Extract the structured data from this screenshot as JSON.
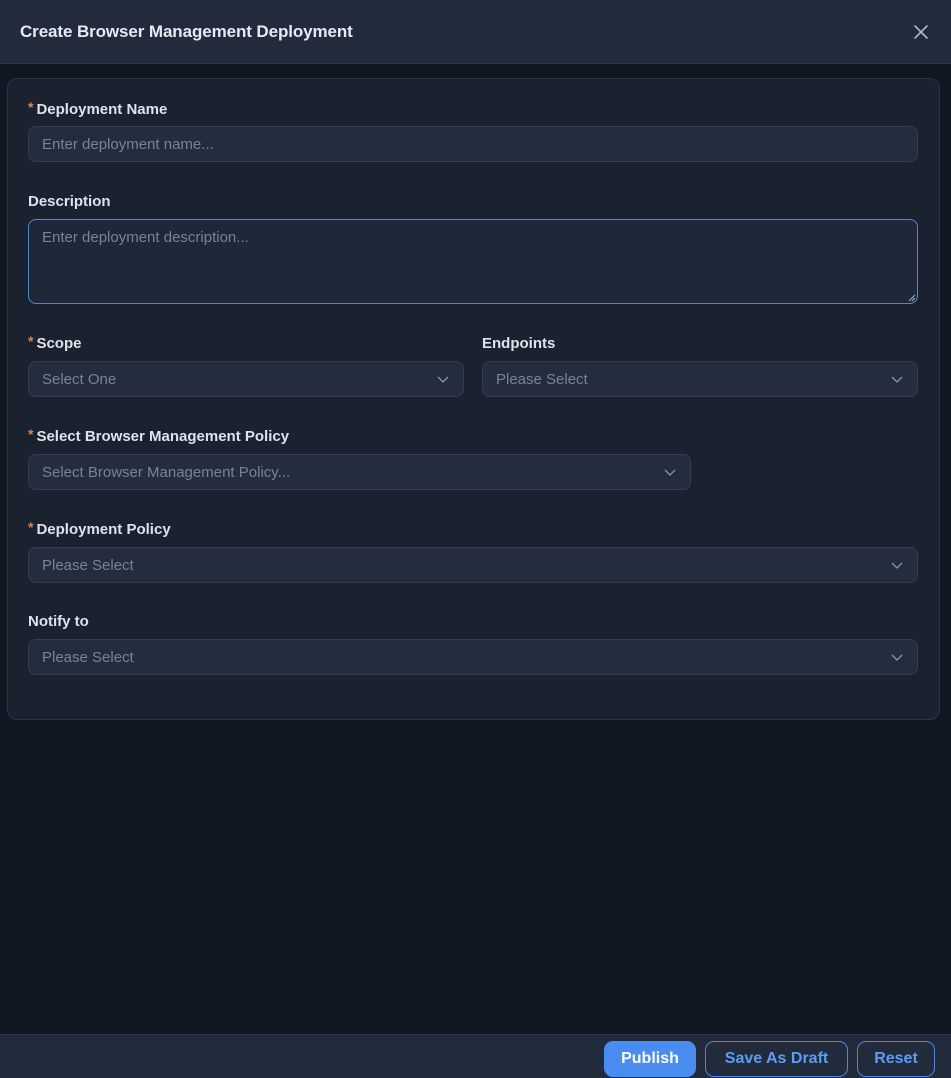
{
  "header": {
    "title": "Create Browser Management Deployment",
    "close_icon": "close-icon"
  },
  "form": {
    "deployment_name": {
      "label": "Deployment Name",
      "required": "*",
      "placeholder": "Enter deployment name...",
      "value": ""
    },
    "description": {
      "label": "Description",
      "placeholder": "Enter deployment description...",
      "value": ""
    },
    "scope": {
      "label": "Scope",
      "required": "*",
      "selected": "Select One"
    },
    "endpoints": {
      "label": "Endpoints",
      "selected": "Please Select"
    },
    "browser_policy": {
      "label": "Select Browser Management Policy",
      "required": "*",
      "selected": "Select Browser Management Policy..."
    },
    "deployment_policy": {
      "label": "Deployment Policy",
      "required": "*",
      "selected": "Please Select"
    },
    "notify_to": {
      "label": "Notify to",
      "selected": "Please Select"
    }
  },
  "footer": {
    "publish_label": "Publish",
    "save_draft_label": "Save As Draft",
    "reset_label": "Reset"
  },
  "colors": {
    "background": "#111722",
    "header": "#212b3b",
    "card": "#1a2230",
    "input": "#242d3d",
    "accent": "#4a8cf0",
    "required_marker": "#e8824b"
  }
}
